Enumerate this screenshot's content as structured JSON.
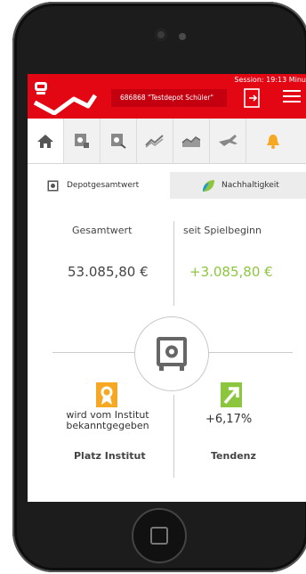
{
  "header": {
    "session": "Session: 19:13 Minu",
    "depot_label": "686868 \"Testdepot Schüler\""
  },
  "nav_icons": [
    "home-icon",
    "depot-overview-icon",
    "depot-search-icon",
    "trend-up-icon",
    "chart-area-icon",
    "plane-icon",
    "bell-icon"
  ],
  "tabs": [
    {
      "label": "Depotgesamtwert",
      "icon": "safe-icon",
      "active": true
    },
    {
      "label": "Nachhaltigkeit",
      "icon": "leaf-icon",
      "active": false
    }
  ],
  "overview": {
    "left_heading": "Gesamtwert",
    "left_value": "53.085,80 €",
    "right_heading": "seit Spielbeginn",
    "right_value": "+3.085,80 €"
  },
  "bottom": {
    "rank_text": "wird vom Institut bekanntgegeben",
    "rank_label": "Platz Institut",
    "trend_value": "+6,17%",
    "trend_label": "Tendenz"
  },
  "colors": {
    "brand_red": "#e30613",
    "gain_green": "#8cc63f",
    "medal_orange": "#f7a823"
  }
}
